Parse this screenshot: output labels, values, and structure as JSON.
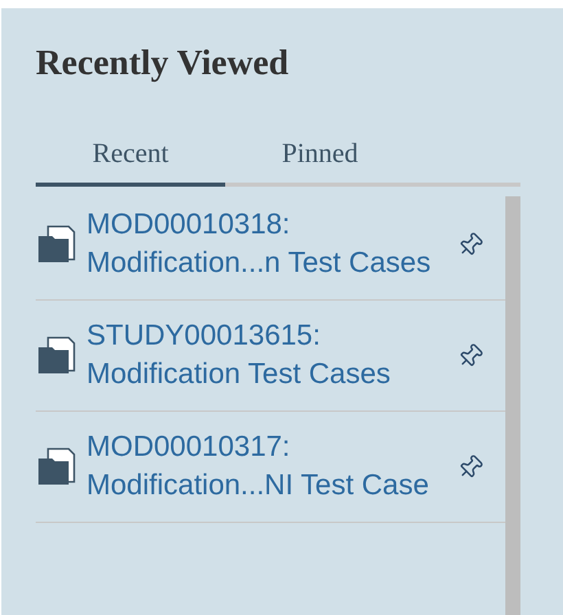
{
  "panel": {
    "title": "Recently Viewed"
  },
  "tabs": [
    {
      "label": "Recent",
      "selected": true
    },
    {
      "label": "Pinned",
      "selected": false
    }
  ],
  "items": [
    {
      "title": "MOD00010318: Modification...n Test Cases"
    },
    {
      "title": "STUDY00013615: Modification Test Cases"
    },
    {
      "title": "MOD00010317: Modification...NI Test Case"
    }
  ]
}
